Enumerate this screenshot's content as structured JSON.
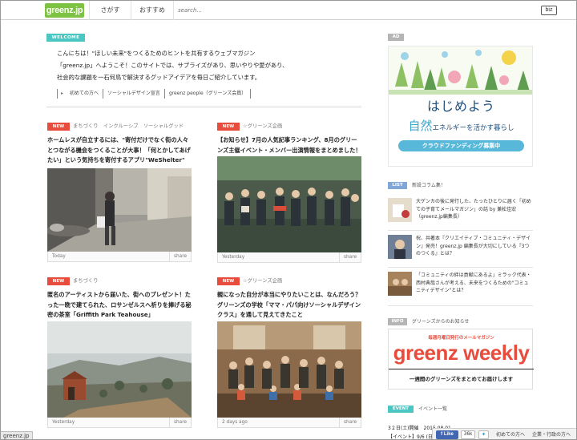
{
  "header": {
    "logo": "greenz.jp",
    "nav": [
      "さがす",
      "おすすめ"
    ],
    "search_placeholder": "search...",
    "biz": "biz"
  },
  "welcome": {
    "badge": "WELCOME",
    "lines": [
      "こんにちは！\"ほしい未来\"をつくるためのヒントを共有するウェブマガジン",
      "「greenz.jp」へようこそ！このサイトでは、サプライズがあり、思いやりや愛があり、",
      "社会的な課題を一石何鳥で解決するグッドアイデアを毎日ご紹介しています。"
    ],
    "links": [
      "初めての方へ",
      "ソーシャルデザイン宣言",
      "greenz people（グリーンズ会員）"
    ]
  },
  "articles": [
    {
      "badge": "NEW",
      "category": "まちづくり　インクルーシブ　ソーシャルグッド",
      "title": "ホームレスが自立するには、\"寄付だけでなく街の人々とつながる機会をつくることが大事！「何とかしてあげたい」という気持ちを寄付するアプリ\"WeShelter\"",
      "date": "Today",
      "share": "share"
    },
    {
      "badge": "NEW",
      "category": "☆グリーンズ企画",
      "title": "【お知らせ】7月の人気記事ランキング、8月のグリーンズ主催イベント・メンバー出演情報をまとめました！",
      "date": "Yesterday",
      "share": "share"
    },
    {
      "badge": "NEW",
      "category": "まちづくり",
      "title": "匿名のアーティストから届いた、街へのプレゼント！たった一晩で建てられた、ロサンゼルスへ祈りを捧げる秘密の茶室「Griffith Park Teahouse」",
      "date": "Yesterday",
      "share": "share"
    },
    {
      "badge": "NEW",
      "category": "☆グリーンズ企画",
      "title": "親になった自分が本当にやりたいことは、なんだろう？グリーンズの学校「ママ・パパ向けソーシャルデザインクラス」を通して見えてきたこと",
      "date": "2 days ago",
      "share": "share"
    }
  ],
  "sidebar": {
    "ad_label": "AD",
    "ad_main": "はじめよう",
    "ad_sub_big": "自然",
    "ad_sub_rest": "エネルギーを活かす暮らし",
    "ad_bar": "クラウドファンディング募集中",
    "list_label": "LIST",
    "list_title": "新設コラム集！",
    "list_items": [
      "大ゲンカの後に発行した、たったひとりに届く「初めての子育てメールマガジン」の話 by 兼松佳宏（greenz.jp編集長）",
      "祝、共著本『クリエイティブ・コミュニティ・デザイン』発売！greenz.jp 編集長が大切にしている『3つのつくる』とは？",
      "「コミュニティの絆は貢献にあるよ」ミラック代表・西村典哉さんが考える、未来をつくるための\"コミュニティデザイン\"とは？"
    ],
    "info_label": "INFO",
    "info_title": "グリーンズからのお知らせ",
    "weekly_small": "毎週月曜日発行のメールマガジン",
    "weekly_big": "greenz weekly",
    "weekly_line": "一週間のグリーンズをまとめてお届けします",
    "event_label": "EVENT",
    "event_title": "イベント一覧",
    "event_date": "3２日(土)開催　2015.08.01",
    "event_line": "【イベント】9/6 (日)"
  },
  "bottom_bar": {
    "like": "Like",
    "count": "36k",
    "links": [
      "初めての方へ",
      "企業・行政の方へ"
    ]
  },
  "status_url": "greenz.jp",
  "colors": {
    "brand_green": "#7dc242",
    "new_red": "#e74c3c",
    "welcome_teal": "#4bc7c3",
    "list_blue": "#7fa8d9",
    "event_teal": "#4bc7c3"
  }
}
